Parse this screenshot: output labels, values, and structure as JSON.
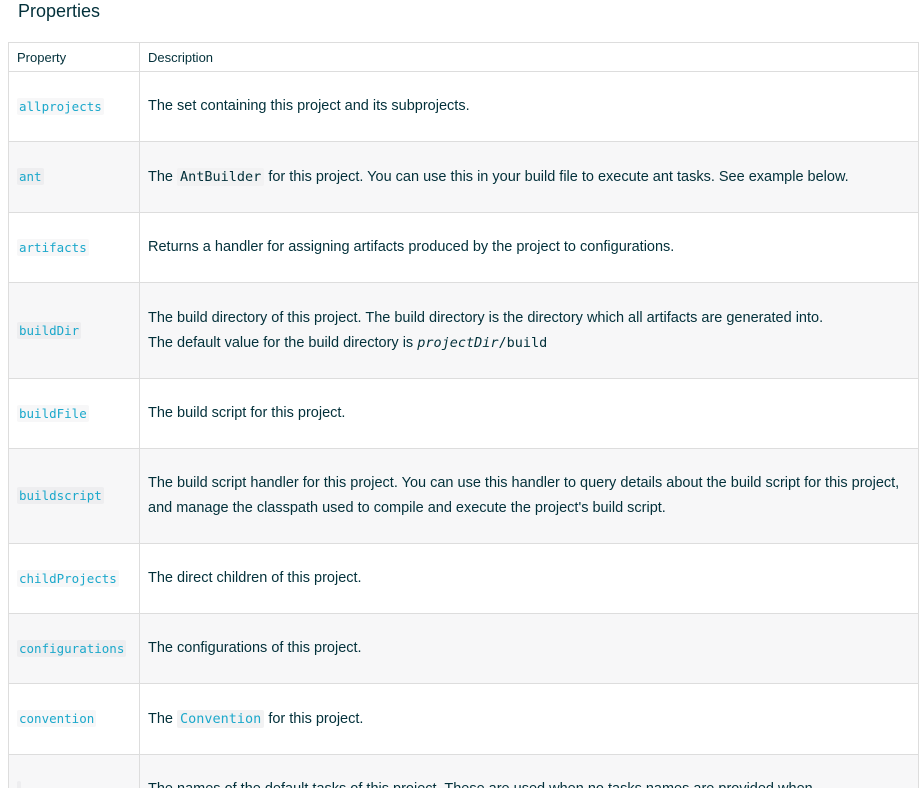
{
  "section": {
    "title": "Properties"
  },
  "table": {
    "headers": {
      "property": "Property",
      "description": "Description"
    },
    "rows": [
      {
        "property": "allprojects",
        "description": "The set containing this project and its subprojects."
      },
      {
        "property": "ant",
        "desc_before": "The ",
        "desc_code": "AntBuilder",
        "desc_after": " for this project. You can use this in your build file to execute ant tasks. See example below."
      },
      {
        "property": "artifacts",
        "description": "Returns a handler for assigning artifacts produced by the project to configurations."
      },
      {
        "property": "buildDir",
        "desc_line1": "The build directory of this project. The build directory is the directory which all artifacts are generated into.",
        "desc_line2": "The default value for the build directory is ",
        "desc_code_italic": "projectDir",
        "desc_code_rest": "/build"
      },
      {
        "property": "buildFile",
        "description": "The build script for this project."
      },
      {
        "property": "buildscript",
        "description": "The build script handler for this project. You can use this handler to query details about the build script for this project, and manage the classpath used to compile and execute the project's build script."
      },
      {
        "property": "childProjects",
        "description": "The direct children of this project."
      },
      {
        "property": "configurations",
        "description": "The configurations of this project."
      },
      {
        "property": "convention",
        "desc_before": "The ",
        "desc_code": "Convention",
        "desc_after": " for this project."
      },
      {
        "property": "",
        "description": "The names of the default tasks of this project. These are used when no tasks names are provided when"
      }
    ]
  }
}
